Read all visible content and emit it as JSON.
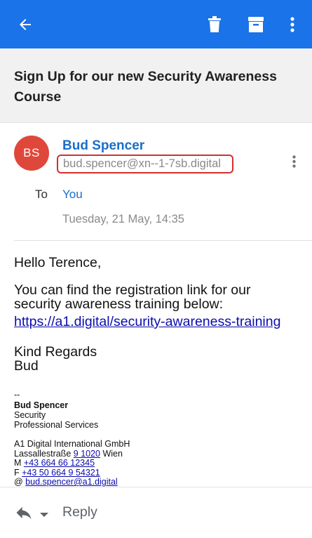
{
  "toolbar": {
    "icons": [
      "back-arrow-icon",
      "trash-icon",
      "archive-icon",
      "more-vert-icon"
    ],
    "bg_color": "#1a73e8"
  },
  "email": {
    "subject": "Sign Up for our new Security Awareness Course",
    "sender": {
      "initials": "BS",
      "name": "Bud Spencer",
      "email": "bud.spencer@xn--1-7sb.digital",
      "avatar_color": "#e0473b"
    },
    "to_label": "To",
    "to_value": "You",
    "date": "Tuesday, 21 May, 14:35",
    "body": {
      "greeting": "Hello Terence,",
      "line1": "You can find the registration link for our",
      "line2": "security awareness training below:",
      "link": "https://a1.digital/security-awareness-training",
      "regards": "Kind Regards",
      "signoff": "Bud"
    },
    "signature": {
      "dashes": "--",
      "name": "Bud Spencer",
      "department": "Security",
      "team": "Professional Services",
      "company": "A1 Digital International GmbH",
      "street_prefix": "Lassallestraße ",
      "street_link": "9 1020",
      "street_suffix": " Wien",
      "mobile_prefix": "M ",
      "mobile": "+43 664 66 12345",
      "fax_prefix": "F ",
      "fax": "+43 50 664 9 54321",
      "email_prefix": "@ ",
      "email": "bud.spencer@a1.digital"
    }
  },
  "footer": {
    "reply_label": "Reply"
  }
}
